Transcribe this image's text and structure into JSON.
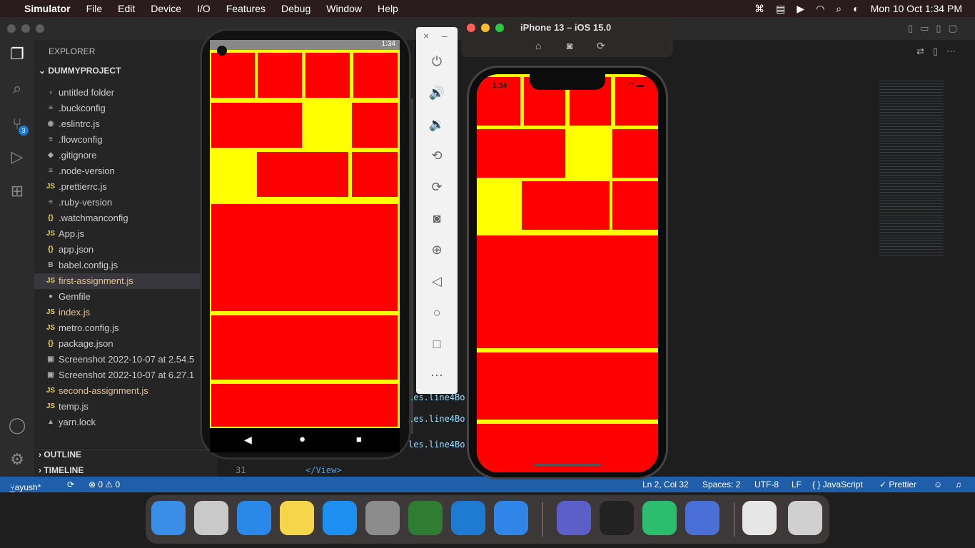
{
  "menubar": {
    "app": "Simulator",
    "items": [
      "File",
      "Edit",
      "Device",
      "I/O",
      "Features",
      "Debug",
      "Window",
      "Help"
    ],
    "clock": "Mon 10 Oct  1:34 PM"
  },
  "vscode": {
    "explorer_title": "EXPLORER",
    "project": "DUMMYPROJECT",
    "files": [
      {
        "icon": "›",
        "name": "untitled folder",
        "color": "#cccccc"
      },
      {
        "icon": "≡",
        "name": ".buckconfig",
        "color": "#cccccc"
      },
      {
        "icon": "◉",
        "name": ".eslintrc.js",
        "color": "#cccccc"
      },
      {
        "icon": "≡",
        "name": ".flowconfig",
        "color": "#cccccc"
      },
      {
        "icon": "◆",
        "name": ".gitignore",
        "color": "#cccccc"
      },
      {
        "icon": "≡",
        "name": ".node-version",
        "color": "#cccccc"
      },
      {
        "icon": "JS",
        "name": ".prettierrc.js",
        "color": "#cccccc"
      },
      {
        "icon": "≡",
        "name": ".ruby-version",
        "color": "#cccccc"
      },
      {
        "icon": "{}",
        "name": ".watchmanconfig",
        "color": "#cccccc"
      },
      {
        "icon": "JS",
        "name": "App.js",
        "color": "#cccccc"
      },
      {
        "icon": "{}",
        "name": "app.json",
        "color": "#cccccc"
      },
      {
        "icon": "B",
        "name": "babel.config.js",
        "color": "#cccccc"
      },
      {
        "icon": "JS",
        "name": "first-assignment.js",
        "color": "#e2c08d"
      },
      {
        "icon": "●",
        "name": "Gemfile",
        "color": "#cccccc"
      },
      {
        "icon": "JS",
        "name": "index.js",
        "color": "#e2c08d"
      },
      {
        "icon": "JS",
        "name": "metro.config.js",
        "color": "#cccccc"
      },
      {
        "icon": "{}",
        "name": "package.json",
        "color": "#cccccc"
      },
      {
        "icon": "▣",
        "name": "Screenshot 2022-10-07 at 2.54.5",
        "color": "#cccccc"
      },
      {
        "icon": "▣",
        "name": "Screenshot 2022-10-07 at 6.27.1",
        "color": "#cccccc"
      },
      {
        "icon": "JS",
        "name": "second-assignment.js",
        "color": "#e2c08d"
      },
      {
        "icon": "JS",
        "name": "temp.js",
        "color": "#cccccc"
      },
      {
        "icon": "▲",
        "name": "yarn.lock",
        "color": "#cccccc"
      }
    ],
    "outline": "OUTLINE",
    "timeline": "TIMELINE",
    "scm_badge": "3",
    "code_line_number": "31",
    "code_line_text": "</View>",
    "code_fragments": [
      "les.line4Bo",
      "les.line4Bo",
      "les.line4Bo"
    ]
  },
  "statusbar": {
    "branch": "_ayush*",
    "problems": "⊗ 0  ⚠ 0",
    "position": "Ln 2, Col 32",
    "spaces": "Spaces: 2",
    "encoding": "UTF-8",
    "eol": "LF",
    "language": "{ } JavaScript",
    "formatter": "✓ Prettier"
  },
  "simulator": {
    "title": "iPhone 13 – iOS 15.0",
    "ios_time": "1:34"
  },
  "android": {
    "time": "1:34"
  },
  "colors": {
    "box": "#ff0000",
    "background": "#ffff00",
    "status_bar": "#1f5ea8"
  },
  "dock": {
    "apps": [
      "finder-icon",
      "launchpad-icon",
      "safari-icon",
      "notes-icon",
      "app-store-icon",
      "system-preferences-icon",
      "android-studio-icon",
      "vscode-icon",
      "xcode-icon",
      "teams-icon",
      "terminal-icon",
      "android-emulator-icon",
      "simulator-icon",
      "preview-icon",
      "trash-icon"
    ]
  }
}
